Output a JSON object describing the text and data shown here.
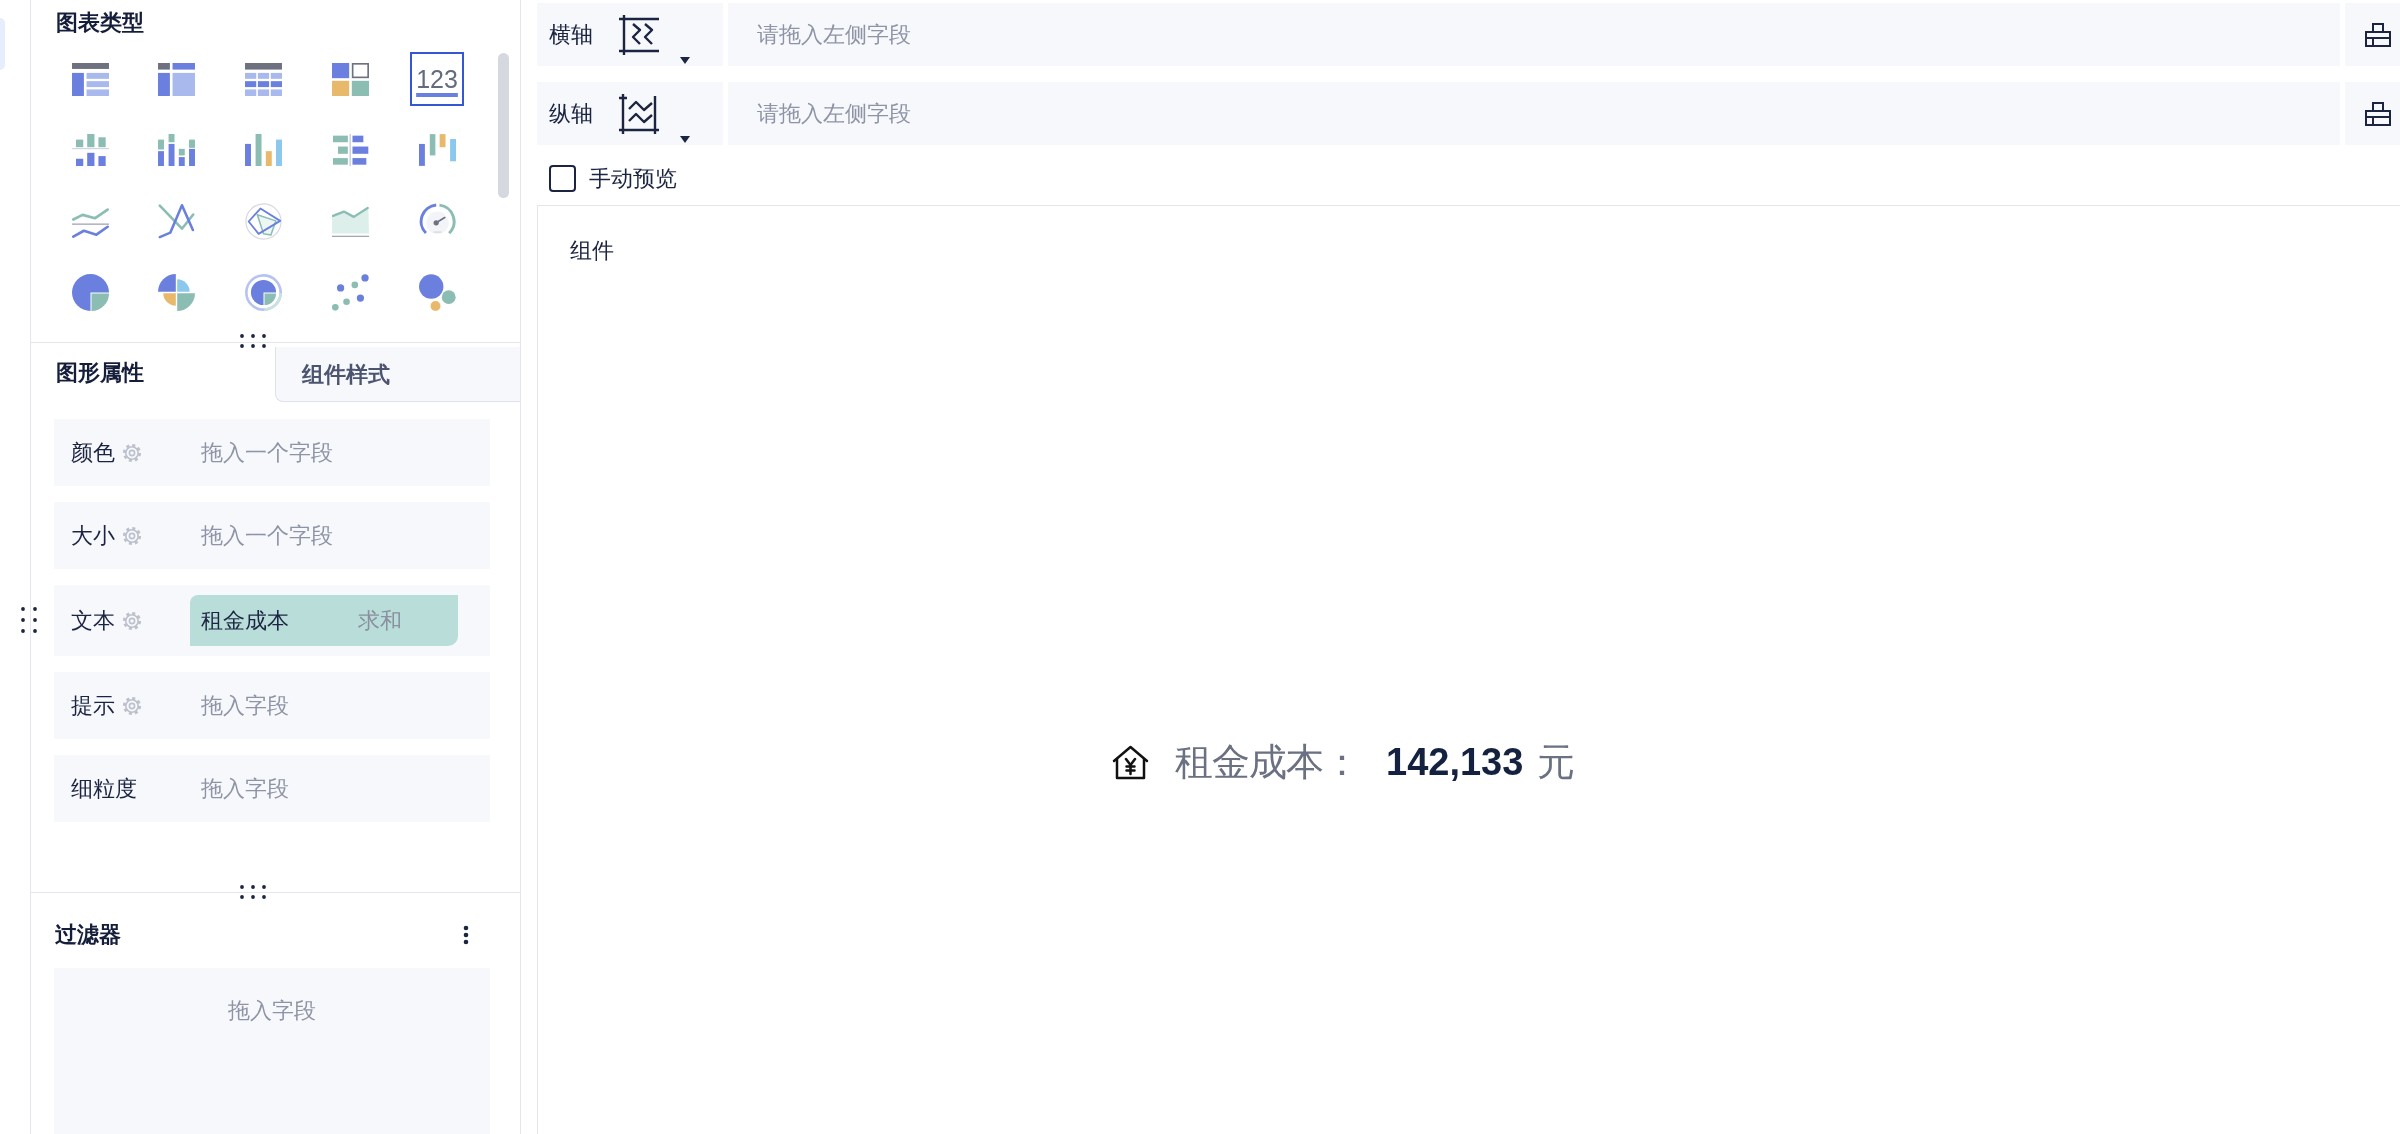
{
  "chart_panel": {
    "title": "图表类型",
    "chart_types": [
      {
        "kind": "detail_table",
        "selected": false
      },
      {
        "kind": "pivot_table",
        "selected": false
      },
      {
        "kind": "grid_table",
        "selected": false
      },
      {
        "kind": "tile",
        "selected": false
      },
      {
        "kind": "number",
        "label": "123",
        "selected": true
      },
      {
        "kind": "diverging_bar",
        "selected": false
      },
      {
        "kind": "stacked_column",
        "selected": false
      },
      {
        "kind": "column",
        "selected": false
      },
      {
        "kind": "butterfly",
        "selected": false
      },
      {
        "kind": "waterfall",
        "selected": false
      },
      {
        "kind": "dual_line",
        "selected": false
      },
      {
        "kind": "line",
        "selected": false
      },
      {
        "kind": "radar",
        "selected": false
      },
      {
        "kind": "area",
        "selected": false
      },
      {
        "kind": "gauge",
        "selected": false
      },
      {
        "kind": "pie",
        "selected": false
      },
      {
        "kind": "rose",
        "selected": false
      },
      {
        "kind": "ring",
        "selected": false
      },
      {
        "kind": "scatter",
        "selected": false
      },
      {
        "kind": "bubble",
        "selected": false
      }
    ]
  },
  "property_tabs": [
    {
      "label": "图形属性",
      "selected": true
    },
    {
      "label": "组件样式",
      "selected": false
    }
  ],
  "properties": [
    {
      "label": "颜色",
      "configurable": true,
      "placeholder": "拖入一个字段"
    },
    {
      "label": "大小",
      "configurable": true,
      "placeholder": "拖入一个字段"
    },
    {
      "label": "文本",
      "configurable": true,
      "field": {
        "name": "租金成本",
        "aggregation": "求和"
      }
    },
    {
      "label": "提示",
      "configurable": true,
      "placeholder": "拖入字段"
    },
    {
      "label": "细粒度",
      "configurable": false,
      "placeholder": "拖入字段"
    }
  ],
  "filter": {
    "title": "过滤器",
    "placeholder": "拖入字段"
  },
  "axes": [
    {
      "kind": "x",
      "label": "横轴",
      "placeholder": "请拖入左侧字段"
    },
    {
      "kind": "y",
      "label": "纵轴",
      "placeholder": "请拖入左侧字段"
    }
  ],
  "manual_preview": {
    "label": "手动预览",
    "checked": false
  },
  "canvas": {
    "title": "组件",
    "metric": {
      "label": "租金成本：",
      "value": "142,133",
      "unit": "元"
    }
  }
}
